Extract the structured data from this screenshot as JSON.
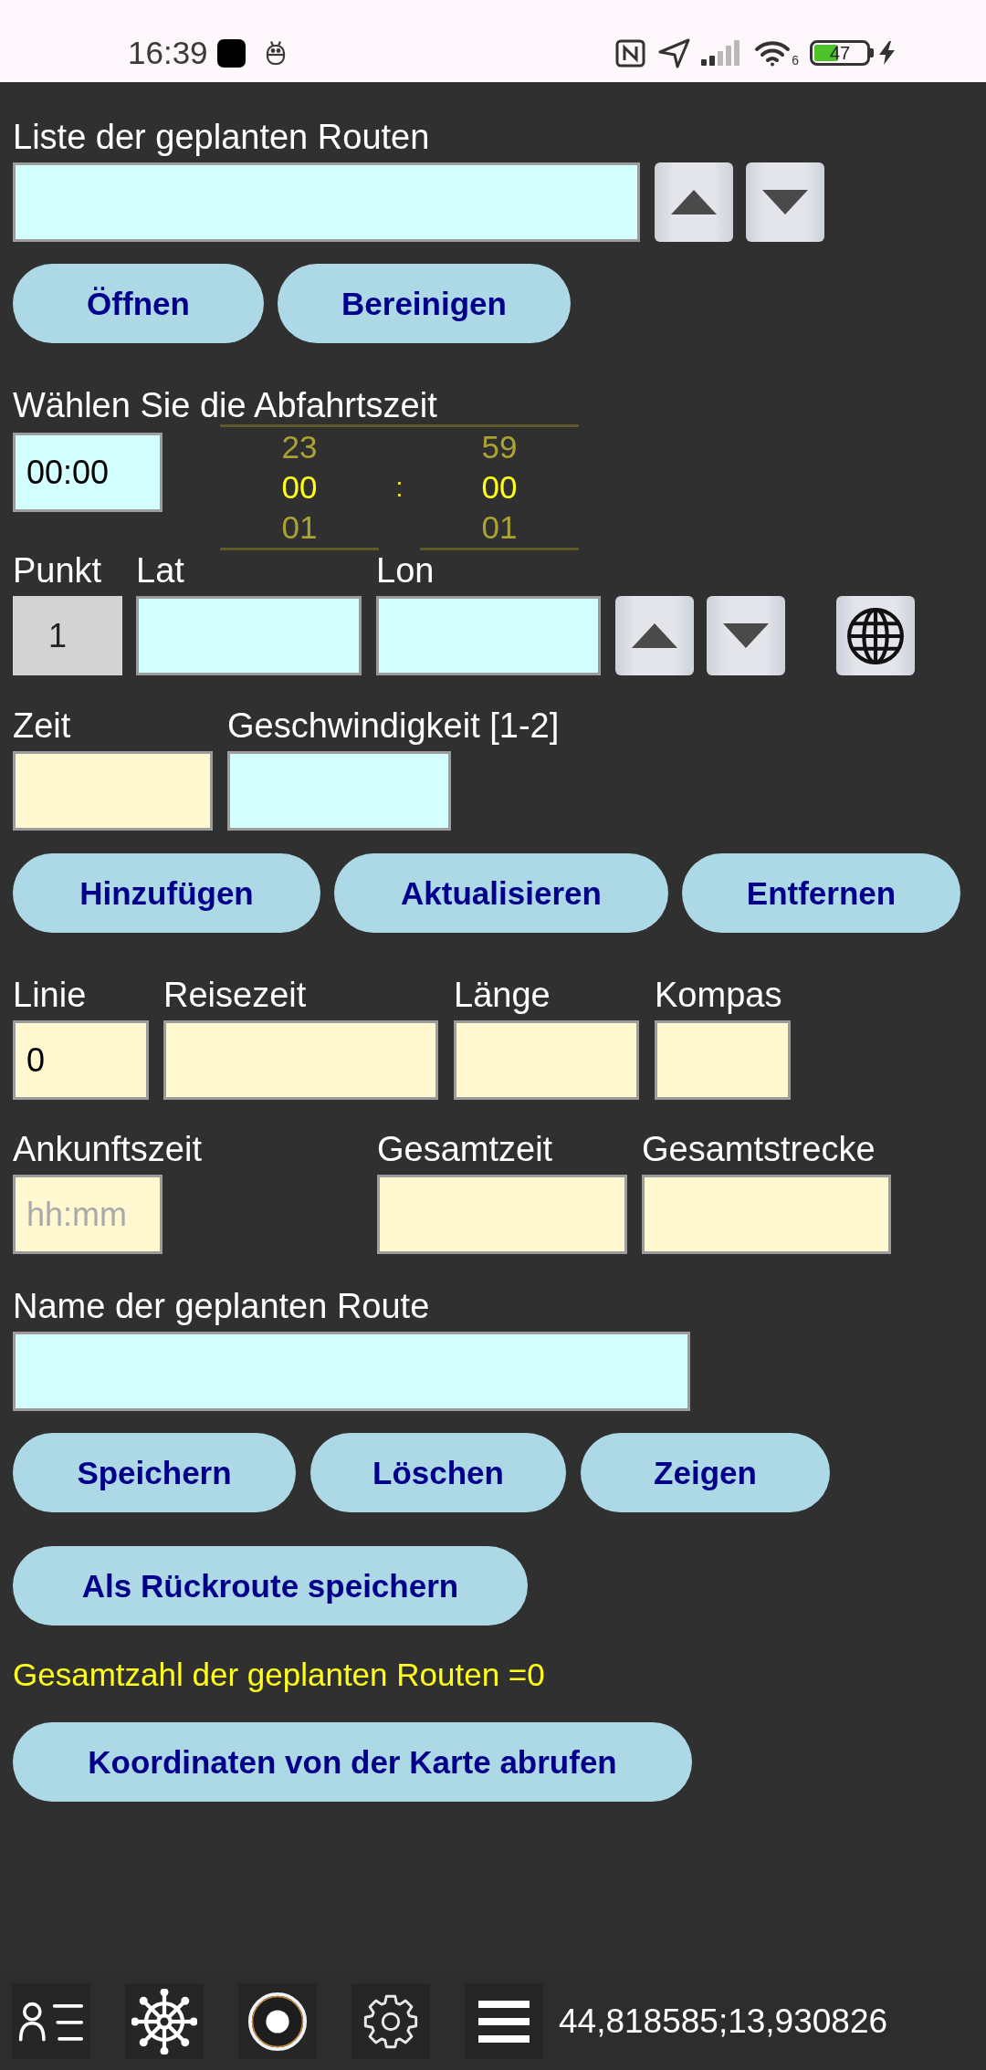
{
  "status_bar": {
    "time": "16:39",
    "wifi_standard": "6",
    "battery": "47"
  },
  "route_list": {
    "label": "Liste der geplanten Routen"
  },
  "list_buttons": [
    {
      "label": "Öffnen"
    },
    {
      "label": "Bereinigen"
    }
  ],
  "departure": {
    "label": "Wählen Sie die Abfahrtszeit",
    "value": "00:00",
    "hours": [
      {
        "value": "23",
        "selected": false
      },
      {
        "value": "00",
        "selected": true
      },
      {
        "value": "01",
        "selected": false
      }
    ],
    "separator": ":",
    "minutes": [
      {
        "value": "59",
        "selected": false
      },
      {
        "value": "00",
        "selected": true
      },
      {
        "value": "01",
        "selected": false
      }
    ]
  },
  "point_fields": [
    {
      "label": "Punkt",
      "value": "1",
      "kind": "readonly"
    },
    {
      "label": "Lat",
      "kind": "input"
    },
    {
      "label": "Lon",
      "kind": "input"
    }
  ],
  "speed_fields": [
    {
      "label": "Zeit",
      "kind": "output"
    },
    {
      "label": "Geschwindigkeit [1-2]",
      "kind": "input"
    }
  ],
  "point_buttons": [
    {
      "label": "Hinzufügen"
    },
    {
      "label": "Aktualisieren"
    },
    {
      "label": "Entfernen"
    }
  ],
  "line_fields": [
    {
      "label": "Linie",
      "value": "0",
      "kind": "output"
    },
    {
      "label": "Reisezeit",
      "kind": "output"
    },
    {
      "label": "Länge",
      "kind": "output"
    },
    {
      "label": "Kompas",
      "kind": "output"
    }
  ],
  "arrival_fields": [
    {
      "label": "Ankunftszeit",
      "placeholder": "hh:mm",
      "kind": "output"
    },
    {
      "label": "Gesamtzeit",
      "kind": "output"
    },
    {
      "label": "Gesamtstrecke",
      "kind": "output"
    }
  ],
  "route_name": {
    "label": "Name der geplanten Route"
  },
  "route_buttons": [
    {
      "label": "Speichern"
    },
    {
      "label": "Löschen"
    },
    {
      "label": "Zeigen"
    }
  ],
  "return_button": {
    "label": "Als Rückroute speichern"
  },
  "route_count": "Gesamtzahl der geplanten Routen =0",
  "map_button": {
    "label": "Koordinaten von der Karte abrufen"
  },
  "bottom_bar": {
    "coordinates": "44,818585;13,930826"
  }
}
